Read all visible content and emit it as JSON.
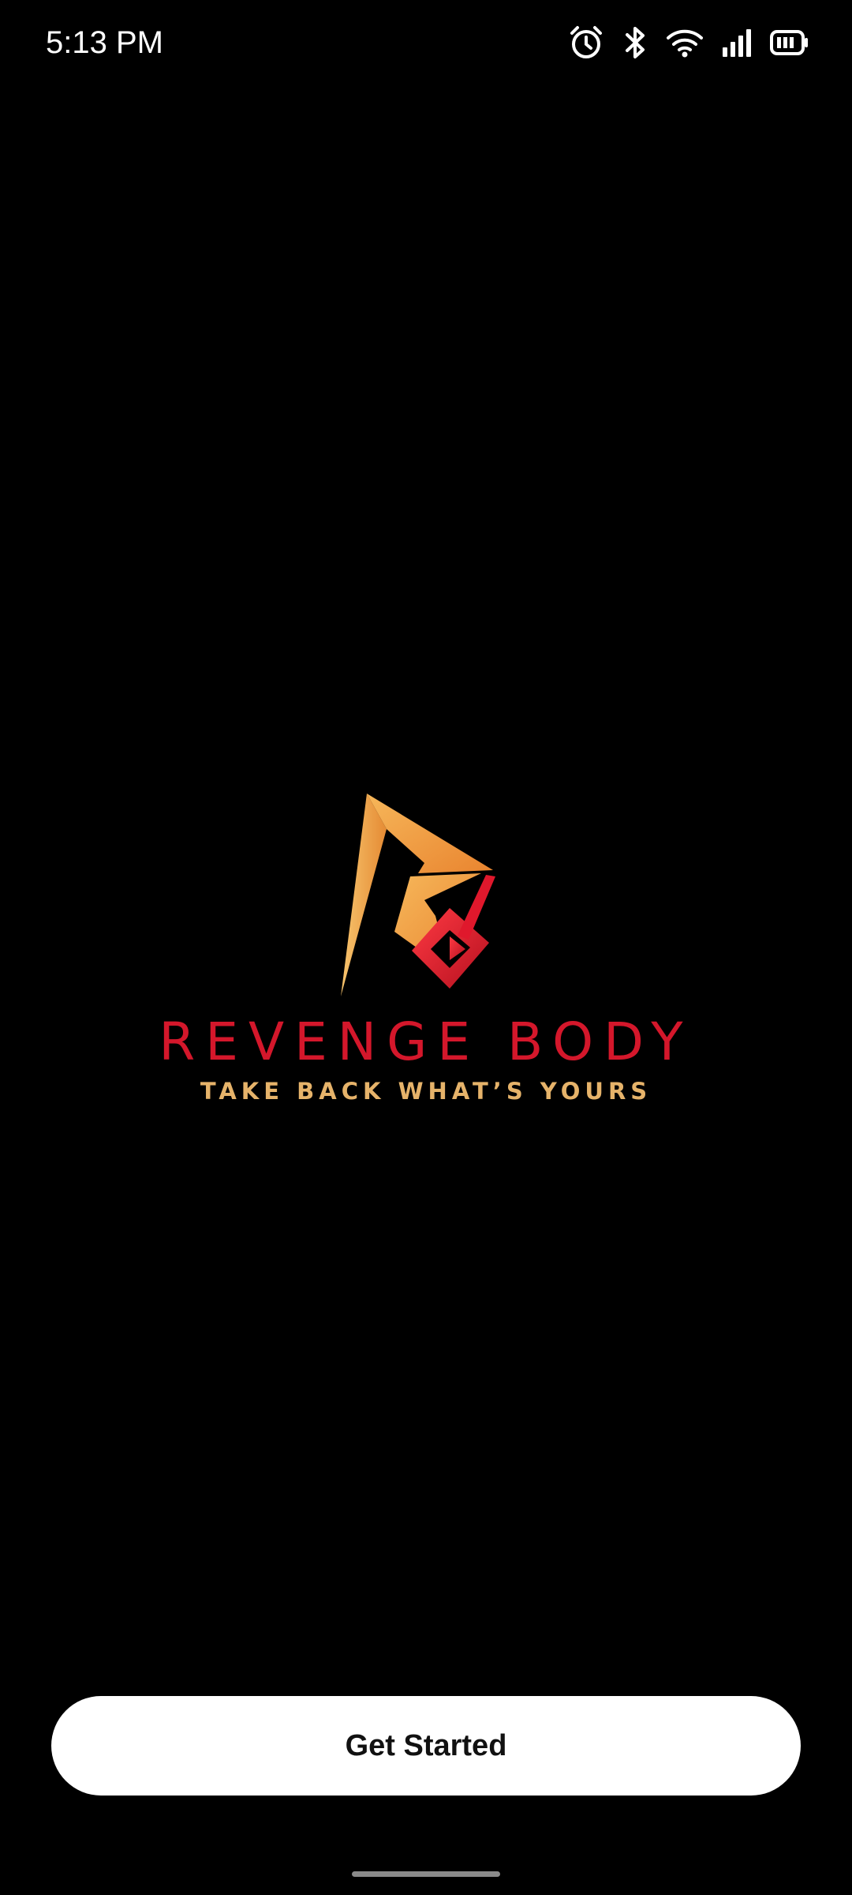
{
  "status_bar": {
    "time": "5:13 PM",
    "icons": [
      "alarm-icon",
      "bluetooth-icon",
      "wifi-icon",
      "signal-icon",
      "battery-icon"
    ]
  },
  "brand": {
    "name": "REVENGE BODY",
    "tagline": "TAKE BACK WHAT’S YOURS"
  },
  "actions": {
    "get_started_label": "Get Started"
  },
  "colors": {
    "background": "#000000",
    "brand_red": "#d4172b",
    "brand_gold": "#e6b36a",
    "button_bg": "#ffffff",
    "button_text": "#111111"
  }
}
